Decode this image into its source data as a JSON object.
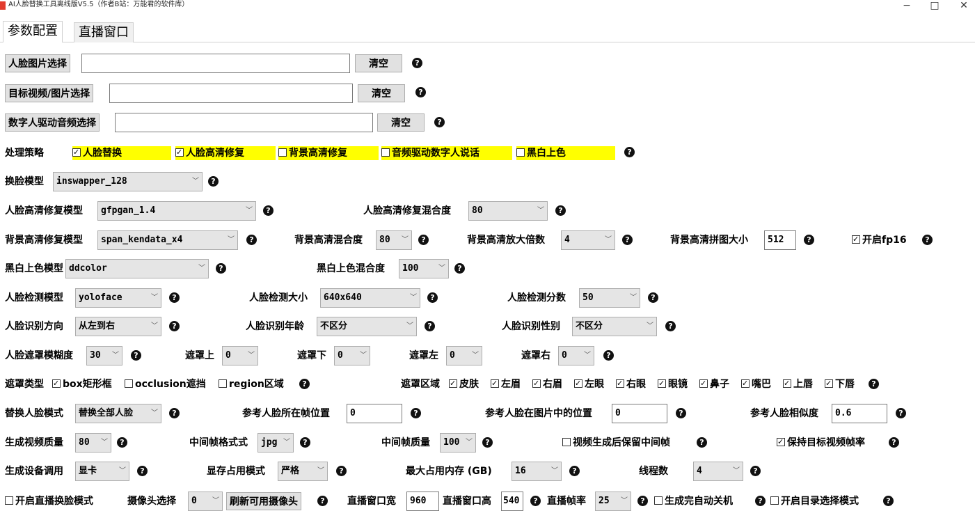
{
  "window": {
    "title": "AI人脸替换工具离线版V5.5（作者B站：万能君的软件库）",
    "minimize": "−",
    "maximize": "□",
    "close": "✕"
  },
  "tabs": [
    {
      "label": "参数配置",
      "active": true
    },
    {
      "label": "直播窗口",
      "active": false
    }
  ],
  "icons": {
    "help": "question-circle-icon",
    "app": "app-icon",
    "checkbox": "checkbox-icon"
  },
  "colors": {
    "highlight": "#ffff00",
    "help_bg": "#111111",
    "app_icon": "#e23b2e"
  },
  "file_rows": {
    "face_image": {
      "button": "人脸图片选择",
      "value": "",
      "clear": "清空"
    },
    "target_media": {
      "button": "目标视频/图片选择",
      "value": "",
      "clear": "清空"
    },
    "audio": {
      "button": "数字人驱动音频选择",
      "value": "",
      "clear": "清空"
    }
  },
  "strategy": {
    "label": "处理策略",
    "options": [
      {
        "label": "人脸替换",
        "checked": true
      },
      {
        "label": "人脸高清修复",
        "checked": true
      },
      {
        "label": "背景高清修复",
        "checked": false
      },
      {
        "label": "音频驱动数字人说话",
        "checked": false
      },
      {
        "label": "黑白上色",
        "checked": false
      }
    ]
  },
  "swap_model": {
    "label": "换脸模型",
    "value": "inswapper_128"
  },
  "face_enhance": {
    "model_label": "人脸高清修复模型",
    "model_value": "gfpgan_1.4",
    "blend_label": "人脸高清修复混合度",
    "blend_value": "80"
  },
  "bg_enhance": {
    "model_label": "背景高清修复模型",
    "model_value": "span_kendata_x4",
    "blend_label": "背景高清混合度",
    "blend_value": "80",
    "scale_label": "背景高清放大倍数",
    "scale_value": "4",
    "tile_label": "背景高清拼图大小",
    "tile_value": "512",
    "fp16_label": "开启fp16",
    "fp16_checked": true
  },
  "colorize": {
    "model_label": "黑白上色模型",
    "model_value": "ddcolor",
    "blend_label": "黑白上色混合度",
    "blend_value": "100"
  },
  "detect": {
    "model_label": "人脸检测模型",
    "model_value": "yoloface",
    "size_label": "人脸检测大小",
    "size_value": "640x640",
    "score_label": "人脸检测分数",
    "score_value": "50"
  },
  "recognize": {
    "dir_label": "人脸识别方向",
    "dir_value": "从左到右",
    "age_label": "人脸识别年龄",
    "age_value": "不区分",
    "gender_label": "人脸识别性别",
    "gender_value": "不区分"
  },
  "mask": {
    "blur_label": "人脸遮罩模糊度",
    "blur_value": "30",
    "top_label": "遮罩上",
    "top_value": "0",
    "bottom_label": "遮罩下",
    "bottom_value": "0",
    "left_label": "遮罩左",
    "left_value": "0",
    "right_label": "遮罩右",
    "right_value": "0"
  },
  "mask_type": {
    "label": "遮罩类型",
    "options": [
      {
        "label": "box矩形框",
        "checked": true
      },
      {
        "label": "occlusion遮挡",
        "checked": false
      },
      {
        "label": "region区域",
        "checked": false
      }
    ],
    "region_label": "遮罩区域",
    "regions": [
      {
        "label": "皮肤",
        "checked": true
      },
      {
        "label": "左眉",
        "checked": true
      },
      {
        "label": "右眉",
        "checked": true
      },
      {
        "label": "左眼",
        "checked": true
      },
      {
        "label": "右眼",
        "checked": true
      },
      {
        "label": "眼镜",
        "checked": true
      },
      {
        "label": "鼻子",
        "checked": true
      },
      {
        "label": "嘴巴",
        "checked": true
      },
      {
        "label": "上唇",
        "checked": true
      },
      {
        "label": "下唇",
        "checked": true
      }
    ]
  },
  "replace": {
    "mode_label": "替换人脸模式",
    "mode_value": "替换全部人脸",
    "frame_label": "参考人脸所在帧位置",
    "frame_value": "0",
    "pos_label": "参考人脸在图片中的位置",
    "pos_value": "0",
    "sim_label": "参考人脸相似度",
    "sim_value": "0.6"
  },
  "output": {
    "quality_label": "生成视频质量",
    "quality_value": "80",
    "fmt_label": "中间帧格式式",
    "fmt_value": "jpg",
    "fq_label": "中间帧质量",
    "fq_value": "100",
    "keep_frames_label": "视频生成后保留中间帧",
    "keep_frames_checked": false,
    "keep_fps_label": "保持目标视频帧率",
    "keep_fps_checked": true
  },
  "device": {
    "dev_label": "生成设备调用",
    "dev_value": "显卡",
    "mem_mode_label": "显存占用模式",
    "mem_mode_value": "严格",
    "max_mem_label": "最大占用内存 (GB)",
    "max_mem_value": "16",
    "threads_label": "线程数",
    "threads_value": "4"
  },
  "live": {
    "enable_label": "开启直播换脸模式",
    "enable_checked": false,
    "camera_label": "摄像头选择",
    "camera_value": "0",
    "refresh_label": "刷新可用摄像头",
    "width_label": "直播窗口宽",
    "width_value": "960",
    "height_label": "直播窗口高",
    "height_value": "540",
    "fps_label": "直播帧率",
    "fps_value": "25",
    "shutdown_label": "生成完自动关机",
    "shutdown_checked": false,
    "dir_mode_label": "开启目录选择模式",
    "dir_mode_checked": false
  }
}
